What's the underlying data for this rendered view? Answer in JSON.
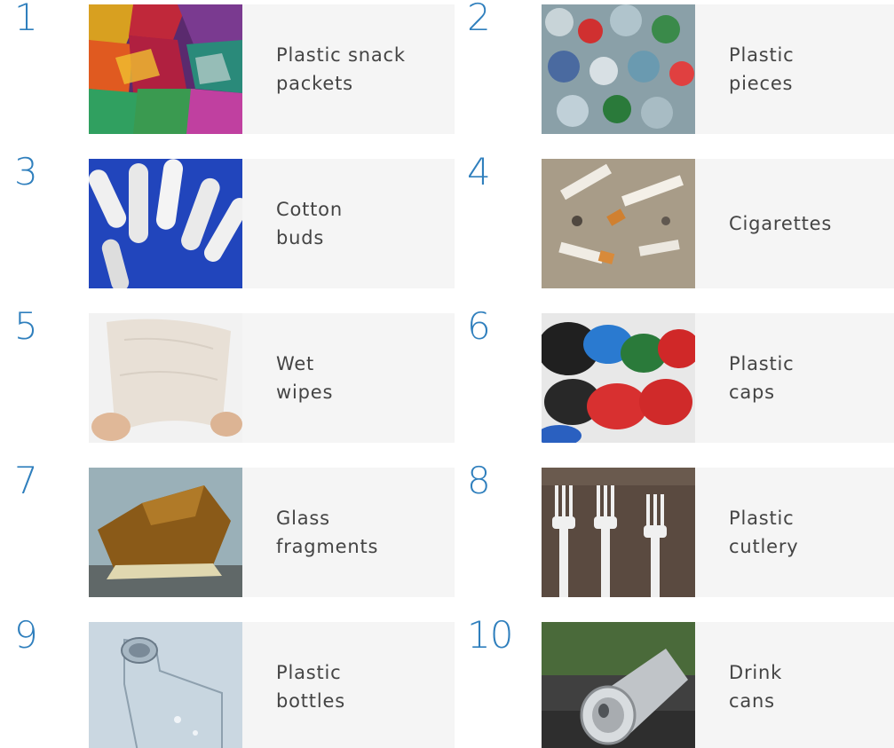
{
  "accent_color": "#2f7fbd",
  "items": [
    {
      "number": "1",
      "label": "Plastic snack\npackets",
      "image": "snack-packets-photo"
    },
    {
      "number": "2",
      "label": "Plastic\npieces",
      "image": "plastic-pieces-photo"
    },
    {
      "number": "3",
      "label": "Cotton\nbuds",
      "image": "cotton-buds-photo"
    },
    {
      "number": "4",
      "label": "Cigarettes",
      "image": "cigarettes-photo"
    },
    {
      "number": "5",
      "label": "Wet\nwipes",
      "image": "wet-wipes-photo"
    },
    {
      "number": "6",
      "label": "Plastic\ncaps",
      "image": "plastic-caps-photo"
    },
    {
      "number": "7",
      "label": "Glass\nfragments",
      "image": "glass-fragments-photo"
    },
    {
      "number": "8",
      "label": "Plastic\ncutlery",
      "image": "plastic-cutlery-photo"
    },
    {
      "number": "9",
      "label": "Plastic\nbottles",
      "image": "plastic-bottles-photo"
    },
    {
      "number": "10",
      "label": "Drink\ncans",
      "image": "drink-cans-photo"
    }
  ]
}
